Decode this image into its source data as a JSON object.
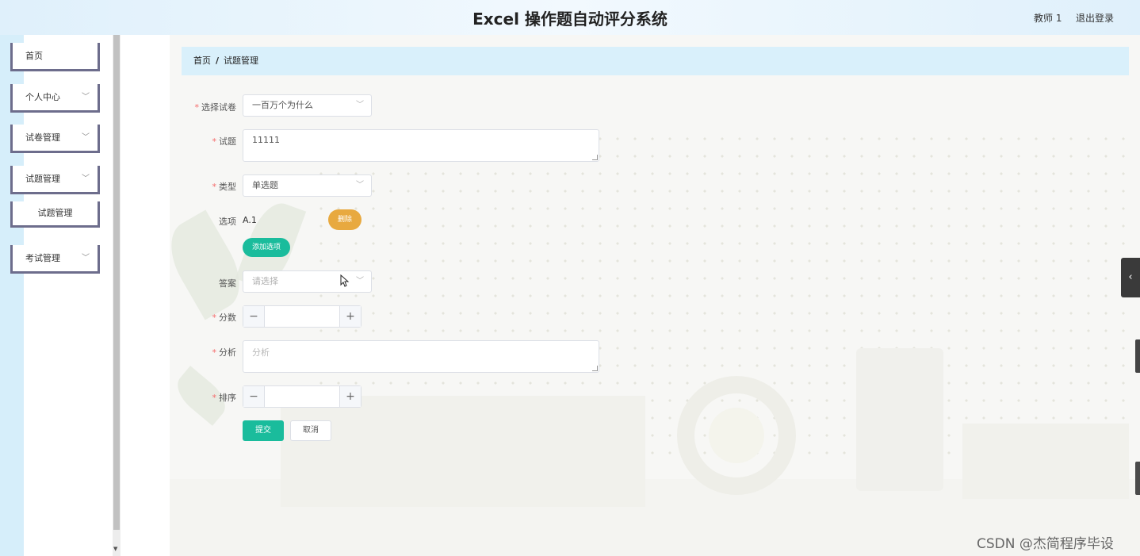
{
  "header": {
    "title": "Excel 操作题自动评分系统",
    "user": "教师 1",
    "logout": "退出登录"
  },
  "sidebar": {
    "items": [
      {
        "label": "首页"
      },
      {
        "label": "个人中心",
        "chevron": "chevron-down-icon"
      },
      {
        "label": "试卷管理",
        "chevron": "chevron-down-icon"
      },
      {
        "label": "试题管理",
        "chevron": "chevron-down-icon",
        "expanded": true
      },
      {
        "label": "考试管理",
        "chevron": "chevron-down-icon"
      }
    ],
    "sub_item": "试题管理"
  },
  "breadcrumb": {
    "home": "首页",
    "separator": "/",
    "current": "试题管理"
  },
  "form": {
    "paper": {
      "label": "选择试卷",
      "value": "一百万个为什么"
    },
    "question": {
      "label": "试题",
      "value": "11111"
    },
    "type": {
      "label": "类型",
      "value": "单选题"
    },
    "options": {
      "label": "选项",
      "items": [
        {
          "text": "A.1",
          "delete_label": "删除"
        }
      ],
      "add_label": "添加选项"
    },
    "answer": {
      "label": "答案",
      "placeholder": "请选择"
    },
    "score": {
      "label": "分数",
      "value": ""
    },
    "analysis": {
      "label": "分析",
      "placeholder": "分析"
    },
    "order": {
      "label": "排序",
      "value": ""
    },
    "required_mark": "*",
    "submit": "提交",
    "cancel": "取消"
  },
  "side_toggle": {
    "icon": "chevron-left-icon",
    "glyph": "‹"
  },
  "watermark": "CSDN @杰简程序毕设",
  "colors": {
    "accent": "#1abc9c",
    "delete": "#e8a93f",
    "breadcrumb_bg": "#d9f0fb",
    "required": "#f56c6c"
  }
}
